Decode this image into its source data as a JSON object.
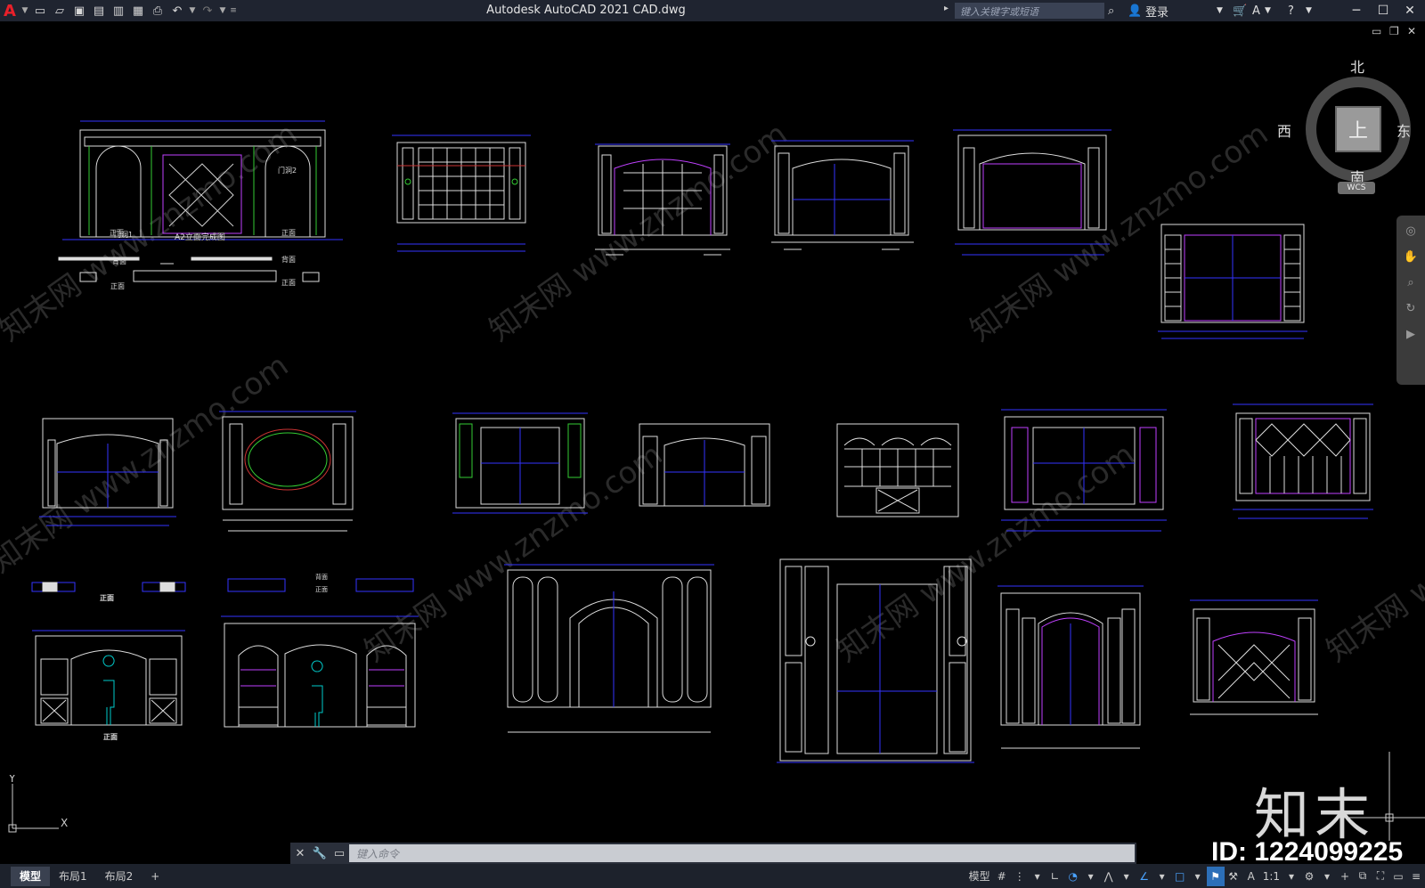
{
  "titlebar": {
    "app_title": "Autodesk AutoCAD 2021    CAD.dwg",
    "search_placeholder": "键入关键字或短语",
    "login_label": "登录"
  },
  "viewcube": {
    "north": "北",
    "south": "南",
    "east": "东",
    "west": "西",
    "face": "上",
    "wcs": "WCS"
  },
  "command": {
    "placeholder": "键入命令"
  },
  "tabs": [
    {
      "label": "模型",
      "active": true
    },
    {
      "label": "布局1",
      "active": false
    },
    {
      "label": "布局2",
      "active": false
    }
  ],
  "status": {
    "model_label": "模型",
    "scale": "1:1"
  },
  "drawing_labels": {
    "front": "正面",
    "back": "背面",
    "door1": "门洞1",
    "door2": "门洞2",
    "elevation_a2": "A2立面完成图",
    "front_bold": "正面",
    "back_small": "背面",
    "front_small": "正面"
  },
  "watermark": {
    "logo": "知末",
    "id": "ID: 1224099225",
    "diag_text": "知末网 www.znzmo.com"
  },
  "ucs": {
    "y": "Y",
    "x": "X"
  }
}
